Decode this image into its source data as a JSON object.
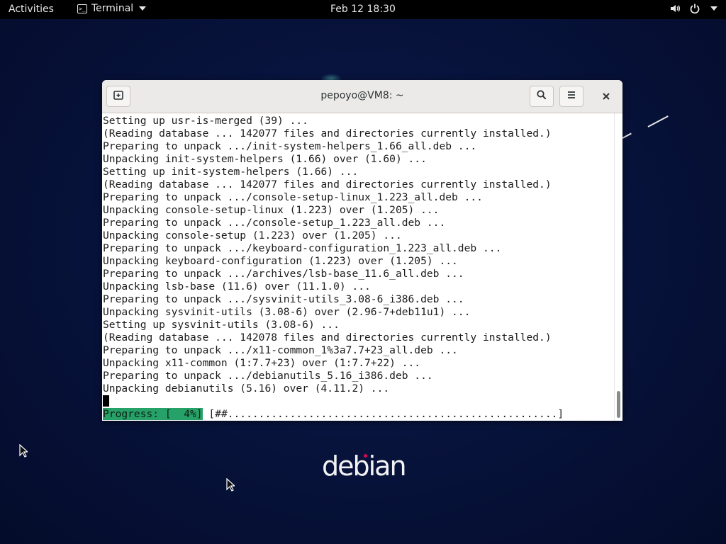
{
  "topbar": {
    "activities": "Activities",
    "app_name": "Terminal",
    "clock": "Feb 12  18:30"
  },
  "window": {
    "title": "pepoyo@VM8: ~",
    "new_tab_icon": "new-tab-icon",
    "search_icon": "search-icon",
    "menu_icon": "hamburger-menu-icon",
    "close_icon": "close-icon"
  },
  "terminal": {
    "lines": [
      "Setting up usr-is-merged (39) ...",
      "(Reading database ... 142077 files and directories currently installed.)",
      "Preparing to unpack .../init-system-helpers_1.66_all.deb ...",
      "Unpacking init-system-helpers (1.66) over (1.60) ...",
      "Setting up init-system-helpers (1.66) ...",
      "(Reading database ... 142077 files and directories currently installed.)",
      "Preparing to unpack .../console-setup-linux_1.223_all.deb ...",
      "Unpacking console-setup-linux (1.223) over (1.205) ...",
      "Preparing to unpack .../console-setup_1.223_all.deb ...",
      "Unpacking console-setup (1.223) over (1.205) ...",
      "Preparing to unpack .../keyboard-configuration_1.223_all.deb ...",
      "Unpacking keyboard-configuration (1.223) over (1.205) ...",
      "Preparing to unpack .../archives/lsb-base_11.6_all.deb ...",
      "Unpacking lsb-base (11.6) over (11.1.0) ...",
      "Preparing to unpack .../sysvinit-utils_3.08-6_i386.deb ...",
      "Unpacking sysvinit-utils (3.08-6) over (2.96-7+deb11u1) ...",
      "Setting up sysvinit-utils (3.08-6) ...",
      "(Reading database ... 142078 files and directories currently installed.)",
      "Preparing to unpack .../x11-common_1%3a7.7+23_all.deb ...",
      "Unpacking x11-common (1:7.7+23) over (1:7.7+22) ...",
      "Preparing to unpack .../debianutils_5.16_i386.deb ...",
      "Unpacking debianutils (5.16) over (4.11.2) ..."
    ],
    "progress_label": "Progress: [  4%]",
    "progress_bar": " [##.....................................................]",
    "progress_percent": 4
  },
  "desktop": {
    "logo_text": "debian"
  },
  "colors": {
    "progress_accent": "#26a269",
    "debian_red": "#d70a53"
  }
}
